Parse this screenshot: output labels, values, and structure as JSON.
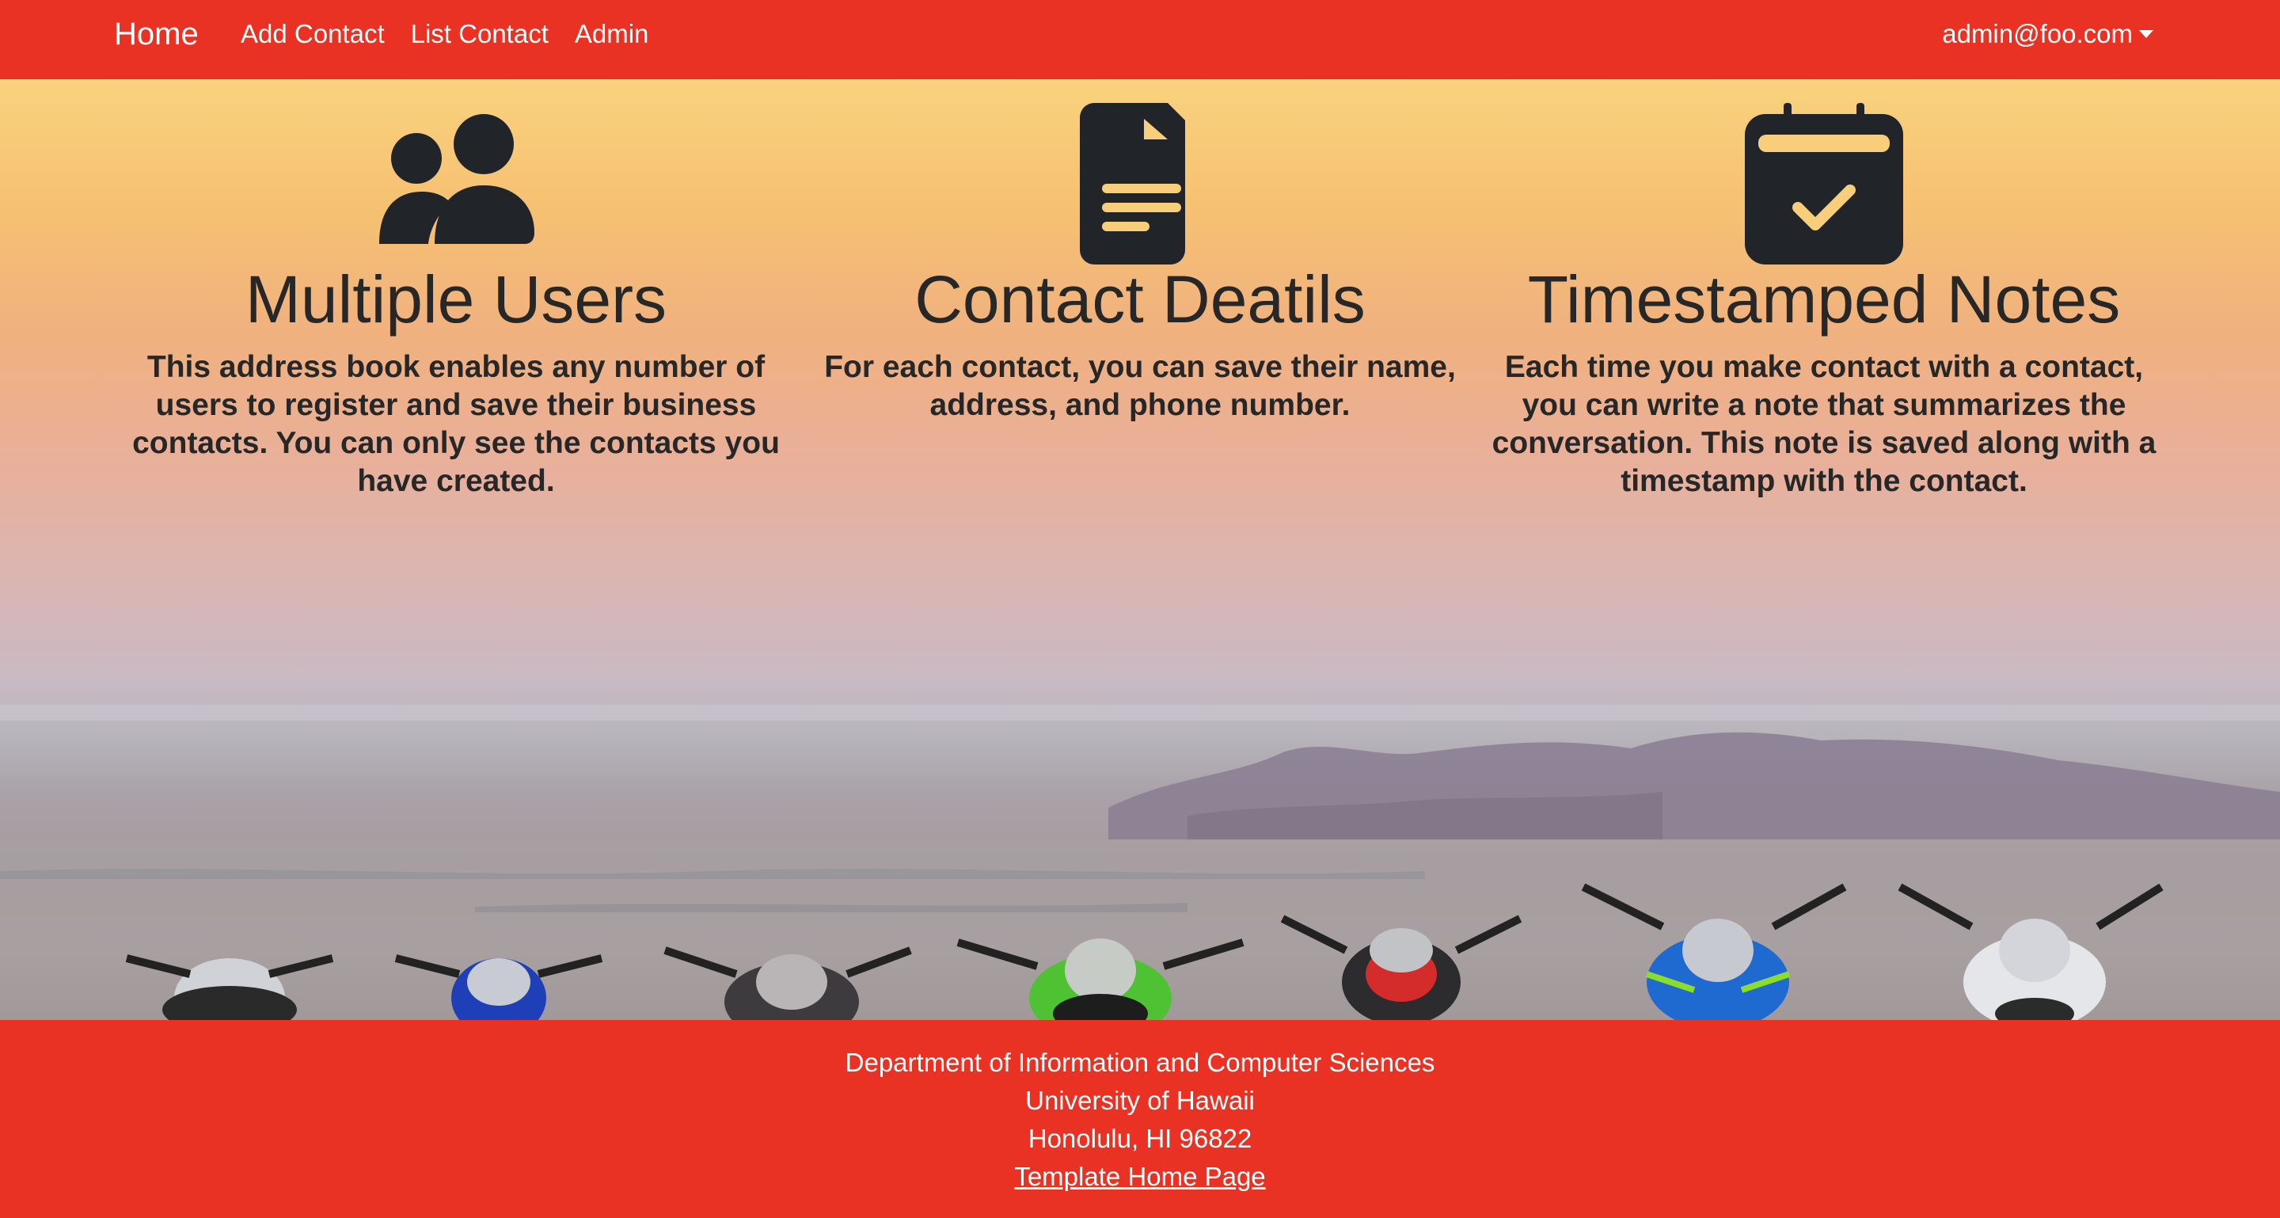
{
  "nav": {
    "brand": "Home",
    "links": [
      "Add Contact",
      "List Contact",
      "Admin"
    ],
    "user": "admin@foo.com"
  },
  "features": [
    {
      "icon": "users-icon",
      "title": "Multiple Users",
      "text": "This address book enables any number of users to register and save their business contacts. You can only see the contacts you have created."
    },
    {
      "icon": "file-text-icon",
      "title": "Contact Deatils",
      "text": "For each contact, you can save their name, address, and phone number."
    },
    {
      "icon": "calendar-check-icon",
      "title": "Timestamped Notes",
      "text": "Each time you make contact with a contact, you can write a note that summarizes the conversation. This note is saved along with a timestamp with the contact."
    }
  ],
  "footer": {
    "lines": [
      "Department of Information and Computer Sciences",
      "University of Hawaii",
      "Honolulu, HI 96822"
    ],
    "link": "Template Home Page"
  },
  "colors": {
    "brand_red": "#e93223",
    "text_dark": "#212529"
  }
}
